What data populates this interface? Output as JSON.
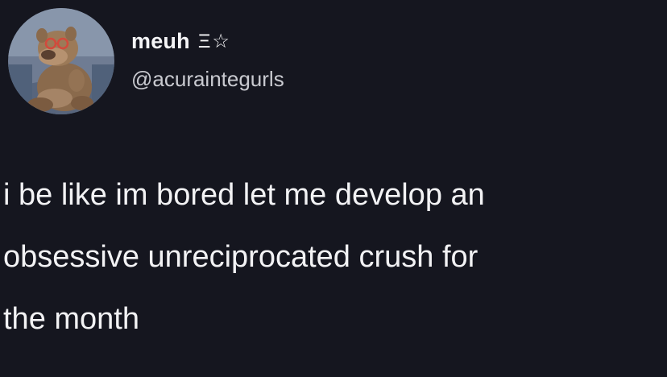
{
  "author": {
    "display_name": "meuh",
    "name_decoration": "Ξ☆",
    "handle": "@acuraintegurls",
    "avatar_icon": "alf-avatar-icon"
  },
  "tweet": {
    "lines": [
      "i be like im bored let me develop an",
      "obsessive unreciprocated crush for",
      "the month"
    ]
  },
  "colors": {
    "background": "#15161f",
    "text": "#f2f2f4",
    "handle": "#c9cad0"
  }
}
